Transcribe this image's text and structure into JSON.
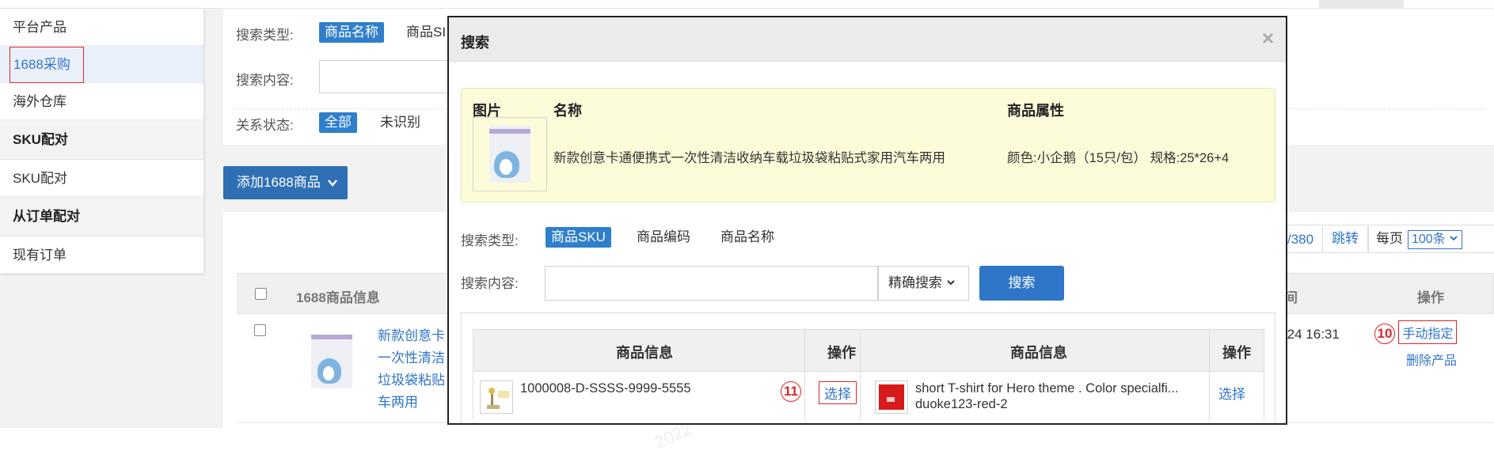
{
  "sidebar": {
    "items": [
      {
        "label": "平台产品"
      },
      {
        "label": "1688采购"
      },
      {
        "label": "海外仓库"
      }
    ],
    "section_sku": "SKU配对",
    "sku_item": "SKU配对",
    "section_order": "从订单配对",
    "order_item": "现有订单"
  },
  "filter": {
    "search_type_label": "搜索类型:",
    "type_product_name": "商品名称",
    "type_product_sku_partial": "商品SI",
    "search_content_label": "搜索内容:",
    "relation_status_label": "关系状态:",
    "status_all": "全部",
    "status_unrecognized": "未识别"
  },
  "add_button": {
    "label": "添加1688商品",
    "icon": "chevron-down-icon"
  },
  "pager": {
    "count": "/380",
    "jump": "跳转",
    "per_page": "每页",
    "per_page_value": "100条"
  },
  "list": {
    "header_product_info": "1688商品信息",
    "header_time_partial": "间",
    "header_ops": "操作",
    "row": {
      "title_lines": [
        "新款创意卡",
        "一次性清洁",
        "垃圾袋粘贴",
        "车两用"
      ],
      "time": "-24 16:31",
      "step_marker": "10",
      "manual_assign": "手动指定",
      "delete_product": "删除产品"
    }
  },
  "watermark": "2022",
  "modal": {
    "title": "搜索",
    "close": "×",
    "info": {
      "col_image": "图片",
      "col_name": "名称",
      "col_attrs": "商品属性",
      "name": "新款创意卡通便携式一次性清洁收纳车载垃圾袋粘贴式家用汽车两用",
      "attrs": "颜色:小企鹅（15只/包） 规格:25*26+4"
    },
    "search_type_label": "搜索类型:",
    "types": [
      "商品SKU",
      "商品编码",
      "商品名称"
    ],
    "search_content_label": "搜索内容:",
    "match_mode": "精确搜索",
    "search_button": "搜索",
    "table": {
      "headers": [
        "商品信息",
        "操作",
        "商品信息",
        "操作"
      ],
      "row": {
        "left_sku": "1000008-D-SSSS-9999-5555",
        "left_step": "11",
        "left_select": "选择",
        "right_title": "short T-shirt for Hero theme . Color specialfi...",
        "right_sku": "duoke123-red-2",
        "right_select": "选择"
      }
    }
  },
  "colors": {
    "accent": "#2f75c8",
    "highlight_box": "#e0242b",
    "info_bg": "#fcfcd9"
  }
}
